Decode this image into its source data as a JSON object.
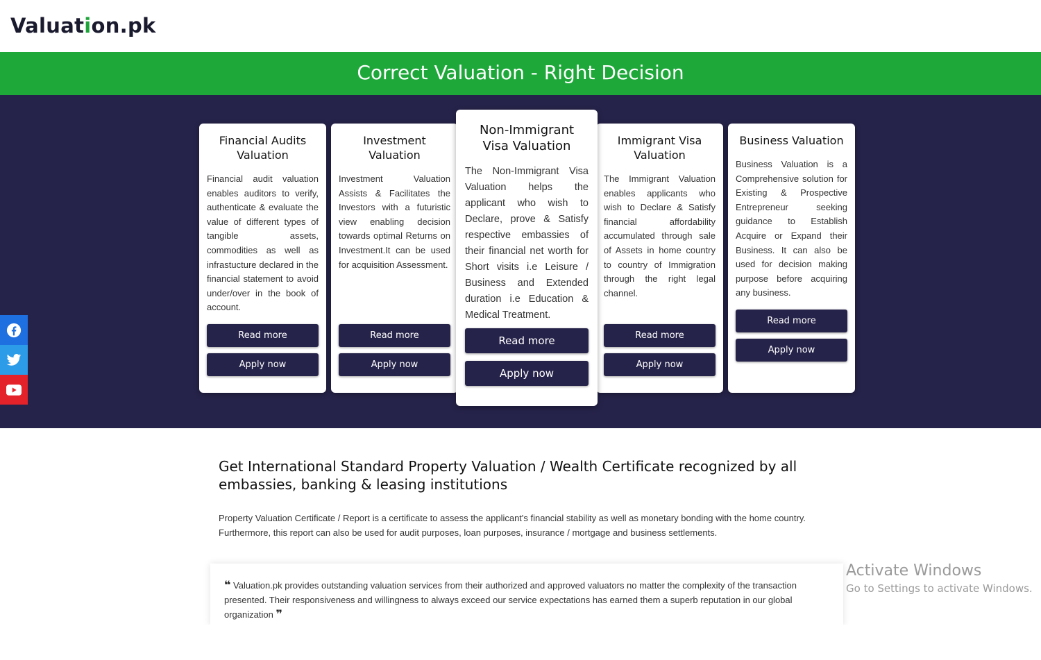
{
  "header": {
    "logo_pre": "Valuat",
    "logo_i": "i",
    "logo_post": "on.pk"
  },
  "banner": {
    "title": "Correct Valuation - Right Decision"
  },
  "cards": [
    {
      "title": "Financial Audits Valuation",
      "text": "Financial audit valuation enables auditors to verify, authenticate & evaluate the value of different types of tangible assets, commodities as well as infrastucture declared in the financial statement to avoid under/over in the book of account.",
      "read_more": "Read more",
      "apply": "Apply now"
    },
    {
      "title": "Investment Valuation",
      "text": "Investment Valuation Assists & Facilitates the Investors with a futuristic view enabling decision towards optimal Returns on Investment.It can be used for acquisition Assessment.",
      "read_more": "Read more",
      "apply": "Apply now"
    },
    {
      "title": "Non-Immigrant Visa Valuation",
      "text": "The Non-Immigrant Visa Valuation helps the applicant who wish to Declare, prove & Satisfy respective embassies of their financial net worth for Short visits i.e Leisure / Business and Extended duration i.e Education & Medical Treatment.",
      "read_more": "Read more",
      "apply": "Apply now"
    },
    {
      "title": "Immigrant Visa Valuation",
      "text": "The Immigrant Valuation enables applicants who wish to Declare & Satisfy financial affordability accumulated through sale of Assets in home country to country of Immigration through the right legal channel.",
      "read_more": "Read more",
      "apply": "Apply now"
    },
    {
      "title": "Business Valuation",
      "text": "Business Valuation is a Comprehensive solution for Existing & Prospective Entrepreneur seeking guidance to Establish Acquire or Expand their Business. It can also be used for decision making purpose before acquiring any business.",
      "read_more": "Read more",
      "apply": "Apply now"
    }
  ],
  "social": [
    "facebook-icon",
    "twitter-icon",
    "youtube-icon"
  ],
  "about": {
    "heading": "Get International Standard Property Valuation / Wealth Certificate recognized by all embassies, banking & leasing institutions",
    "body": "Property Valuation Certificate / Report is a certificate to assess the applicant's financial stability as well as monetary bonding with the home country. Furthermore, this report can also be used for audit purposes, loan purposes, insurance / mortgage and business settlements."
  },
  "testimonial": {
    "open_mark": "❝",
    "text": "Valuation.pk provides outstanding valuation services from their authorized and approved valuators no matter the complexity of the transaction presented. Their responsiveness and willingness to always exceed our service expectations has earned them a superb reputation in our global organization",
    "close_mark": "❞"
  },
  "watermark": {
    "line1": "Activate Windows",
    "line2": "Go to Settings to activate Windows."
  },
  "colors": {
    "brand_green": "#1ea83a",
    "navy": "#26234a",
    "facebook": "#1e6fe0",
    "twitter": "#2c9be8",
    "youtube": "#e4222a"
  }
}
